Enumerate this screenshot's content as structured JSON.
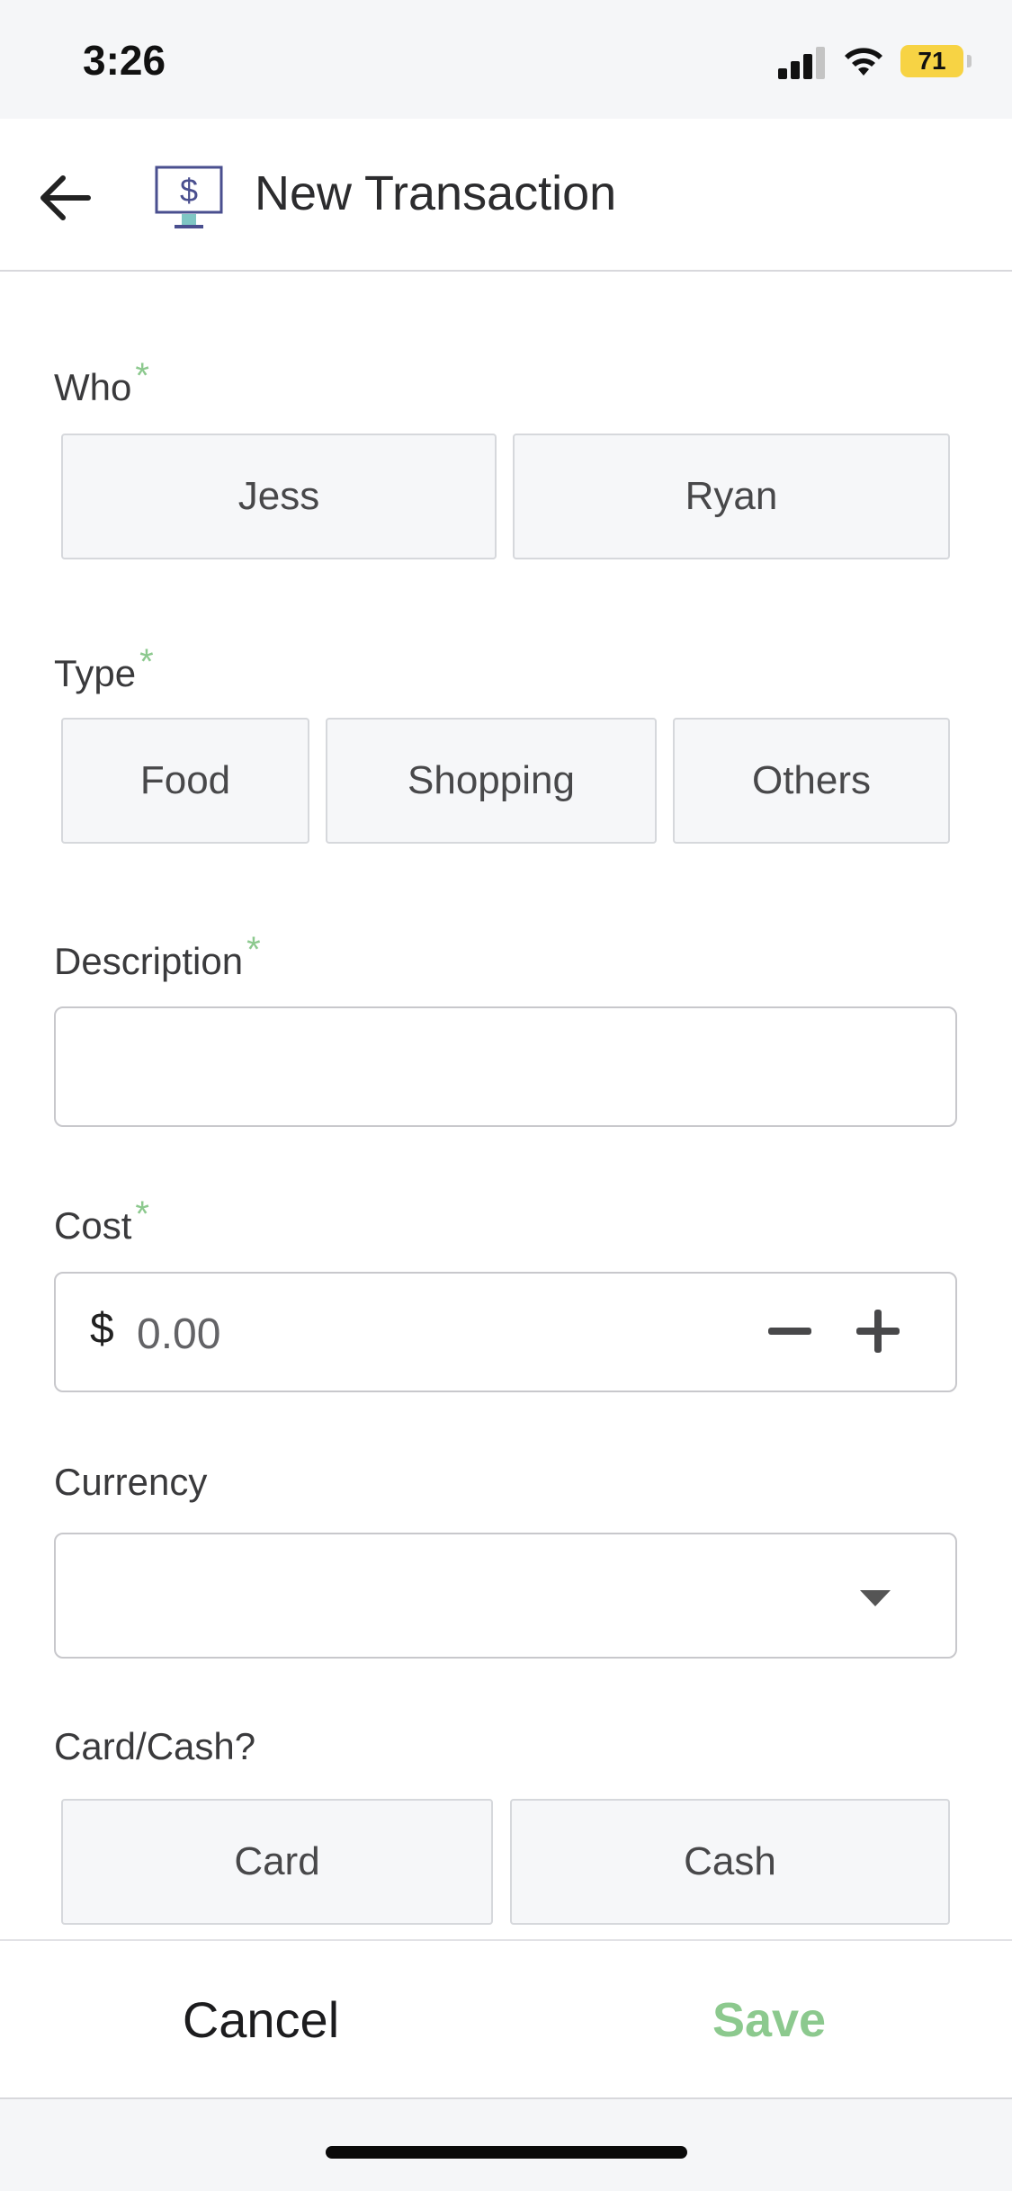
{
  "status_bar": {
    "time": "3:26",
    "battery": "71"
  },
  "header": {
    "title": "New Transaction"
  },
  "who": {
    "label": "Who",
    "required": "*",
    "options": [
      "Jess",
      "Ryan"
    ]
  },
  "type": {
    "label": "Type",
    "required": "*",
    "options": [
      "Food",
      "Shopping",
      "Others"
    ]
  },
  "description": {
    "label": "Description",
    "required": "*",
    "value": ""
  },
  "cost": {
    "label": "Cost",
    "required": "*",
    "currency_symbol": "$",
    "placeholder": "0.00"
  },
  "currency": {
    "label": "Currency",
    "selected": ""
  },
  "payment": {
    "label": "Card/Cash?",
    "options": [
      "Card",
      "Cash"
    ]
  },
  "footer": {
    "cancel_label": "Cancel",
    "save_label": "Save"
  },
  "colors": {
    "accent": "#8cc98e",
    "background": "#f5f6f8"
  }
}
